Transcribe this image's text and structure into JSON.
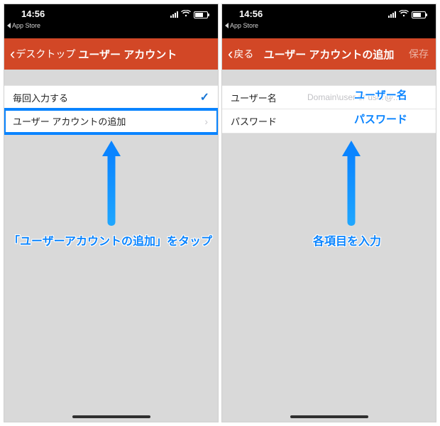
{
  "colors": {
    "nav_bg": "#d24726",
    "highlight": "#0a84ff",
    "check": "#1776d6"
  },
  "status": {
    "time": "14:56",
    "back_app": "App Store"
  },
  "left": {
    "nav_back": "デスクトップ",
    "nav_title": "ユーザー アカウント",
    "row_every_time": "毎回入力する",
    "row_add_account": "ユーザー アカウントの追加",
    "annotation": "「ユーザーアカウントの追加」をタップ"
  },
  "right": {
    "nav_back": "戻る",
    "nav_title": "ユーザー アカウントの追加",
    "nav_save": "保存",
    "row_username_label": "ユーザー名",
    "row_username_placeholder": "Domain\\user or user@...",
    "row_password_label": "パスワード",
    "ann_username": "ユーザー名",
    "ann_password": "パスワード",
    "annotation": "各項目を入力"
  }
}
